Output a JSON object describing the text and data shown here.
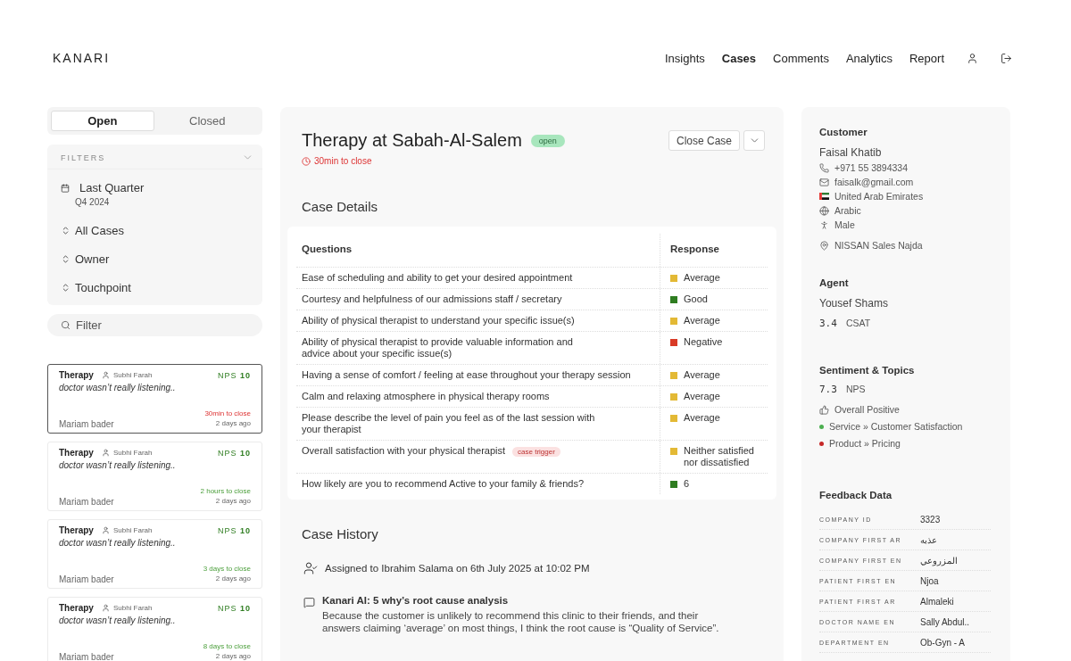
{
  "header": {
    "logo": "KANARI",
    "nav": [
      {
        "label": "Insights",
        "selected": false
      },
      {
        "label": "Cases",
        "selected": true
      },
      {
        "label": "Comments",
        "selected": false
      },
      {
        "label": "Analytics",
        "selected": false
      },
      {
        "label": "Report",
        "selected": false
      }
    ]
  },
  "status_tabs": [
    {
      "label": "Open",
      "selected": true
    },
    {
      "label": "Closed",
      "selected": false
    }
  ],
  "filters": {
    "title": "FILTERS",
    "expanded": true,
    "period": {
      "label": "Last Quarter",
      "sub": "Q4 2024"
    },
    "selects": [
      "All Cases",
      "Owner",
      "Touchpoint"
    ]
  },
  "search": {
    "placeholder": "Filter"
  },
  "cases": [
    {
      "category": "Therapy",
      "owner": "Subhi Farah",
      "comment": "doctor wasn’t really listening..",
      "nps_label": "NPS",
      "nps": "10",
      "due": "30min to close",
      "urgent": true,
      "customer": "Mariam bader",
      "age": "2 days ago",
      "selected": true
    },
    {
      "category": "Therapy",
      "owner": "Subhi Farah",
      "comment": "doctor wasn’t really listening..",
      "nps_label": "NPS",
      "nps": "10",
      "due": "2 hours to close",
      "urgent": false,
      "customer": "Mariam bader",
      "age": "2 days ago",
      "selected": false
    },
    {
      "category": "Therapy",
      "owner": "Subhi Farah",
      "comment": "doctor wasn’t really listening..",
      "nps_label": "NPS",
      "nps": "10",
      "due": "3 days to close",
      "urgent": false,
      "customer": "Mariam bader",
      "age": "2 days ago",
      "selected": false
    },
    {
      "category": "Therapy",
      "owner": "Subhi Farah",
      "comment": "doctor wasn’t really listening..",
      "nps_label": "NPS",
      "nps": "10",
      "due": "8 days to close",
      "urgent": false,
      "customer": "Mariam bader",
      "age": "2 days ago",
      "selected": false
    }
  ],
  "case": {
    "title": "Therapy at Sabah-Al-Salem",
    "status": "open",
    "due": "30min to close",
    "close_button": "Close Case",
    "details": {
      "title": "Case Details",
      "columns": [
        "Questions",
        "Response"
      ],
      "rows": [
        {
          "question": "Ease of scheduling and ability to get your desired appointment",
          "response": "Average",
          "color": "#e3b935"
        },
        {
          "question": "Courtesy and helpfulness of our admissions staff / secretary",
          "response": "Good",
          "color": "#2f7d21"
        },
        {
          "question": "Ability of physical therapist to understand your specific issue(s)",
          "response": "Average",
          "color": "#e3b935"
        },
        {
          "question": "Ability of physical therapist to provide valuable information and advice about your specific issue(s)",
          "response": "Negative",
          "color": "#d93a26"
        },
        {
          "question": "Having a sense of comfort / feeling at ease throughout your therapy session",
          "response": "Average",
          "color": "#e3b935"
        },
        {
          "question": "Calm and relaxing atmosphere in physical therapy rooms",
          "response": "Average",
          "color": "#e3b935"
        },
        {
          "question": "Please describe the level of pain you feel as of the last session with your therapist",
          "response": "Average",
          "color": "#e3b935"
        },
        {
          "question": "Overall satisfaction with your physical therapist",
          "tag": "case trigger",
          "response": "Neither satisfied nor dissatisfied",
          "color": "#e3b935"
        },
        {
          "question": "How likely are you to recommend Active to your family & friends?",
          "response": "6",
          "color": "#2f7d21"
        }
      ]
    },
    "history": {
      "title": "Case History",
      "events": [
        {
          "kind": "assign",
          "text": "Assigned to Ibrahim Salama on 6th July 2025 at 10:02 PM"
        },
        {
          "kind": "ai",
          "title": "Kanari AI: 5 why’s root cause analysis",
          "text": "Because the customer is unlikely to recommend this clinic to their friends, and their answers claiming ‘average’ on most things, I think the root cause is “Quality of Service”."
        }
      ]
    }
  },
  "customer": {
    "heading": "Customer",
    "name": "Faisal Khatib",
    "contacts": [
      {
        "kind": "phone",
        "text": "+971 55 3894334"
      },
      {
        "kind": "email",
        "text": "faisalk@gmail.com"
      },
      {
        "kind": "flag",
        "text": "United Arab Emirates"
      },
      {
        "kind": "language",
        "text": "Arabic"
      },
      {
        "kind": "gender",
        "text": "Male"
      },
      {
        "kind": "location",
        "text": "NISSAN Sales Najda"
      }
    ]
  },
  "agent": {
    "heading": "Agent",
    "name": "Yousef Shams",
    "score": "3.4",
    "score_label": "CSAT"
  },
  "sentiment": {
    "heading": "Sentiment & Topics",
    "score": "7.3",
    "score_label": "NPS",
    "overall": "Overall Positive",
    "topics": [
      {
        "text": "Service » Customer Satisfaction",
        "color": "#4caf50"
      },
      {
        "text": "Product » Pricing",
        "color": "#c62828"
      }
    ]
  },
  "feedback": {
    "heading": "Feedback Data",
    "rows": [
      {
        "label": "COMPANY ID",
        "value": "3323"
      },
      {
        "label": "COMPANY FIRST AR",
        "value": "عذبه"
      },
      {
        "label": "COMPANY FIRST EN",
        "value": "المزروعي"
      },
      {
        "label": "PATIENT FIRST EN",
        "value": "Njoa"
      },
      {
        "label": "PATIENT FIRST AR",
        "value": "Almaleki"
      },
      {
        "label": "DOCTOR NAME EN",
        "value": "Sally Abdul.."
      },
      {
        "label": "DEPARTMENT EN",
        "value": "Ob-Gyn - A"
      }
    ]
  }
}
